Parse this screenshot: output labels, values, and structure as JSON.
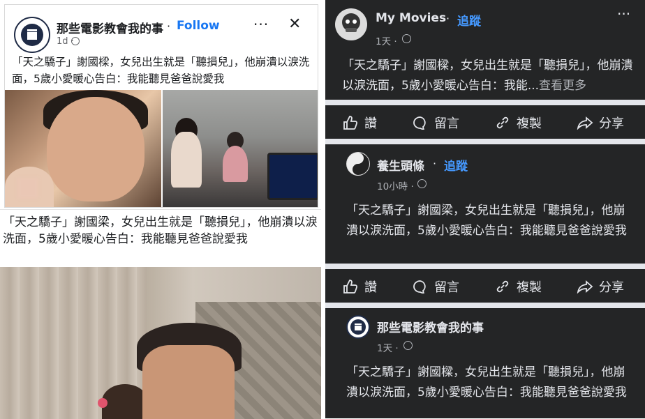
{
  "left_top": {
    "page_name": "那些電影教會我的事",
    "separator": "·",
    "follow": "Follow",
    "time": "1d ·",
    "more": "···",
    "close": "✕",
    "post_text": "「天之驕子」謝國樑，女兒出生就是「聽損兒」，他崩潰以淚洗面，5歲小愛暖心告白：我能聽見爸爸說愛我"
  },
  "left_bottom": {
    "post_text": "「天之驕子」謝國梁，女兒出生就是「聽損兒」，他崩潰以淚洗面，5歲小愛暖心告白：我能聽見爸爸說愛我"
  },
  "right": {
    "post1": {
      "name": "My Movies",
      "separator": "·",
      "follow": "追蹤",
      "time": "1天 ·",
      "more": "···",
      "text": "「天之驕子」謝國樑，女兒出生就是「聽損兒」，他崩潰以淚洗面，5歲小愛暖心告白：我能...",
      "see_more": "查看更多"
    },
    "post2": {
      "name": "養生頭條",
      "separator": "·",
      "follow": "追蹤",
      "time": "10小時 ·",
      "text": "「天之驕子」謝國梁，女兒出生就是「聽損兒」，他崩潰以淚洗面，5歲小愛暖心告白：我能聽見爸爸說愛我"
    },
    "post3": {
      "name": "那些電影教會我的事",
      "time": "1天 ·",
      "text": "「天之驕子」謝國樑，女兒出生就是「聽損兒」，他崩潰以淚洗面，5歲小愛暖心告白：我能聽見爸爸說愛我"
    },
    "actions": {
      "like": "讚",
      "comment": "留言",
      "copy": "複製",
      "share": "分享"
    }
  },
  "colors": {
    "facebook_blue": "#1877f2",
    "dark_bg": "#242526",
    "dark_text": "#e4e6eb",
    "dark_secondary": "#b0b3b8"
  },
  "icons": [
    "film-slate-icon",
    "globe-icon",
    "more-icon",
    "close-icon",
    "like-icon",
    "comment-icon",
    "copy-link-icon",
    "share-icon"
  ]
}
